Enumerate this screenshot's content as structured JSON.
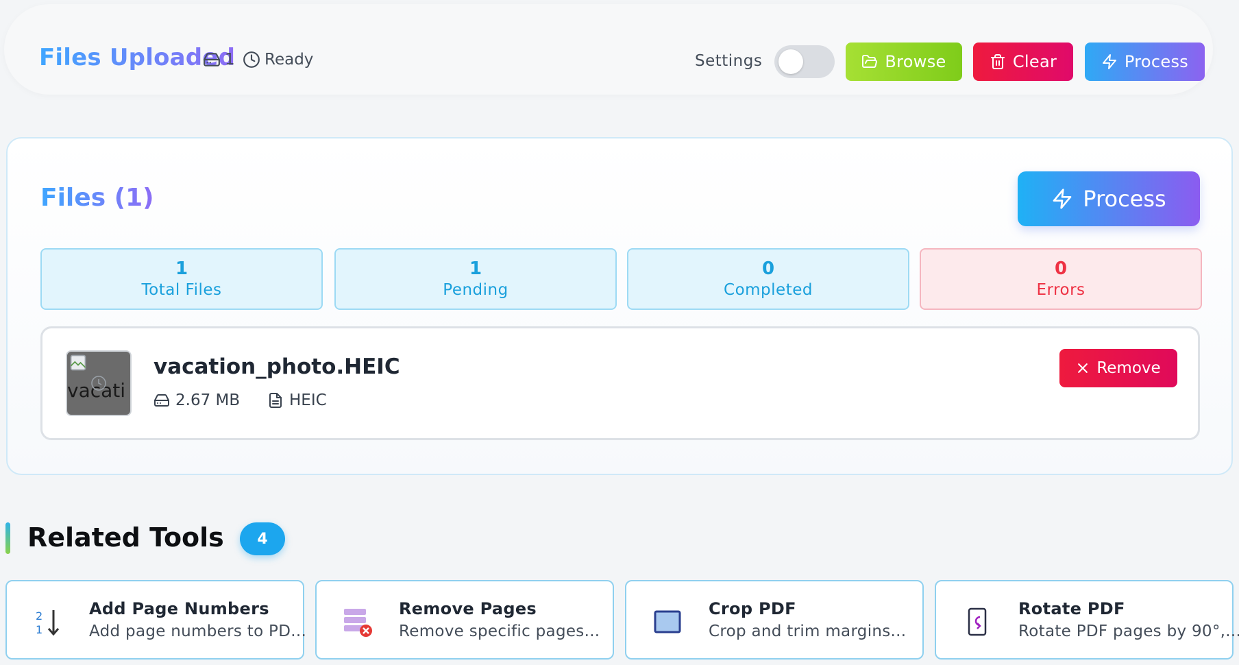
{
  "header": {
    "title": "Files Uploaded",
    "file_count": "1",
    "status": "Ready",
    "settings_label": "Settings",
    "settings_enabled": false,
    "browse_label": "Browse",
    "clear_label": "Clear",
    "process_label": "Process"
  },
  "panel": {
    "title": "Files (1)",
    "process_label": "Process",
    "stats": [
      {
        "value": "1",
        "label": "Total Files"
      },
      {
        "value": "1",
        "label": "Pending"
      },
      {
        "value": "0",
        "label": "Completed"
      },
      {
        "value": "0",
        "label": "Errors"
      }
    ],
    "file": {
      "name": "vacation_photo.HEIC",
      "thumb_alt": "vacati",
      "size": "2.67 MB",
      "type": "HEIC",
      "remove_label": "Remove"
    }
  },
  "related": {
    "title": "Related Tools",
    "count": "4",
    "tools": [
      {
        "name": "Add Page Numbers",
        "desc": "Add page numbers to PD...",
        "icon": "page-numbers-icon"
      },
      {
        "name": "Remove Pages",
        "desc": "Remove specific pages...",
        "icon": "remove-pages-icon"
      },
      {
        "name": "Crop PDF",
        "desc": "Crop and trim margins...",
        "icon": "crop-icon"
      },
      {
        "name": "Rotate PDF",
        "desc": "Rotate PDF pages by 90°,...",
        "icon": "rotate-icon"
      }
    ]
  },
  "colors": {
    "accent_blue": "#1ca6ee",
    "browse_green": "#8ed626",
    "danger_red": "#ee1a3e",
    "gradient_start": "#3fa6ff",
    "gradient_end": "#8d6cf5"
  }
}
